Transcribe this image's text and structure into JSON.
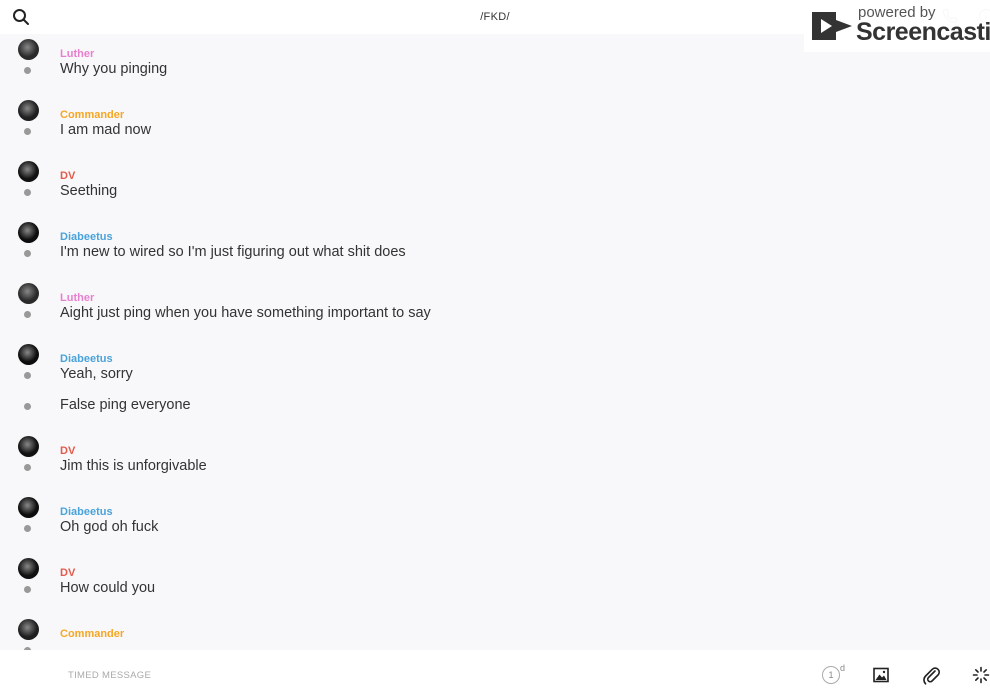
{
  "header": {
    "title": "/FKD/",
    "watermark_powered": "powered by",
    "watermark_brand": "Screencastify"
  },
  "colors": {
    "Luther": "#e87fcf",
    "Commander": "#f5a623",
    "DV": "#e45a4a",
    "Diabeetus": "#4aa3d9"
  },
  "messages": [
    {
      "sender": "Luther",
      "text": "Why you pinging"
    },
    {
      "sender": "Commander",
      "text": "I am mad now"
    },
    {
      "sender": "DV",
      "text": "Seething"
    },
    {
      "sender": "Diabeetus",
      "text": "I'm new to wired so I'm just figuring out what shit does"
    },
    {
      "sender": "Luther",
      "text": "Aight just ping when you have something important to say"
    },
    {
      "sender": "Diabeetus",
      "text": "Yeah, sorry",
      "followup": "False ping everyone"
    },
    {
      "sender": "DV",
      "text": "Jim this is unforgivable"
    },
    {
      "sender": "Diabeetus",
      "text": "Oh god oh fuck"
    },
    {
      "sender": "DV",
      "text": "How could you"
    },
    {
      "sender": "Commander",
      "text": ""
    }
  ],
  "composer": {
    "timed_label": "TIMED MESSAGE",
    "timer_value": "1",
    "timer_unit": "d"
  },
  "icons": {
    "search": "search-icon",
    "phone": "phone-icon",
    "info": "info-icon",
    "image": "image-icon",
    "attach": "paperclip-icon",
    "magic": "sparkle-icon"
  }
}
